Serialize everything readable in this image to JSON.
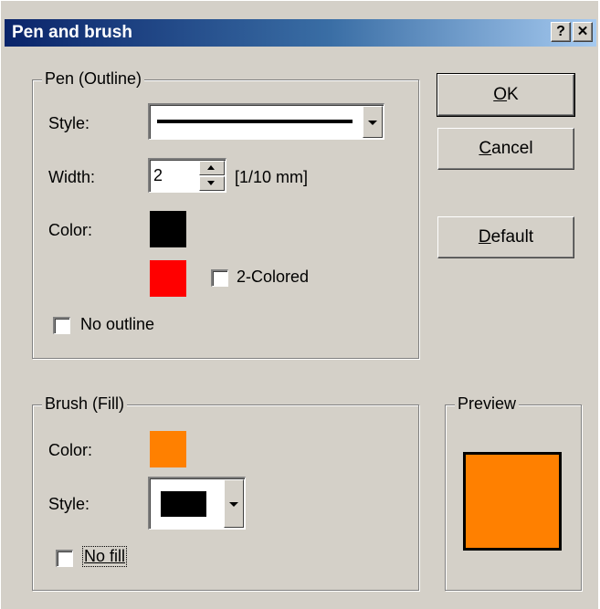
{
  "dialog": {
    "title": "Pen and brush",
    "help_label": "?",
    "close_label": "✕"
  },
  "pen": {
    "group_label": "Pen (Outline)",
    "style_label": "Style:",
    "width_label": "Width:",
    "width_value": "2",
    "width_unit": "[1/10 mm]",
    "color_label": "Color:",
    "color_primary": "#000000",
    "color_secondary": "#ff0000",
    "two_colored_label": "2-Colored",
    "two_colored_checked": false,
    "no_outline_label": "No outline",
    "no_outline_checked": false
  },
  "brush": {
    "group_label": "Brush (Fill)",
    "color_label": "Color:",
    "color": "#ff8000",
    "style_label": "Style:",
    "style_swatch": "#000000",
    "no_fill_label": "No fill",
    "no_fill_checked": false
  },
  "preview": {
    "group_label": "Preview",
    "fill": "#ff8000",
    "outline": "#000000"
  },
  "buttons": {
    "ok_key": "O",
    "ok_rest": "K",
    "cancel_key": "C",
    "cancel_rest": "ancel",
    "default_key": "D",
    "default_rest": "efault"
  }
}
